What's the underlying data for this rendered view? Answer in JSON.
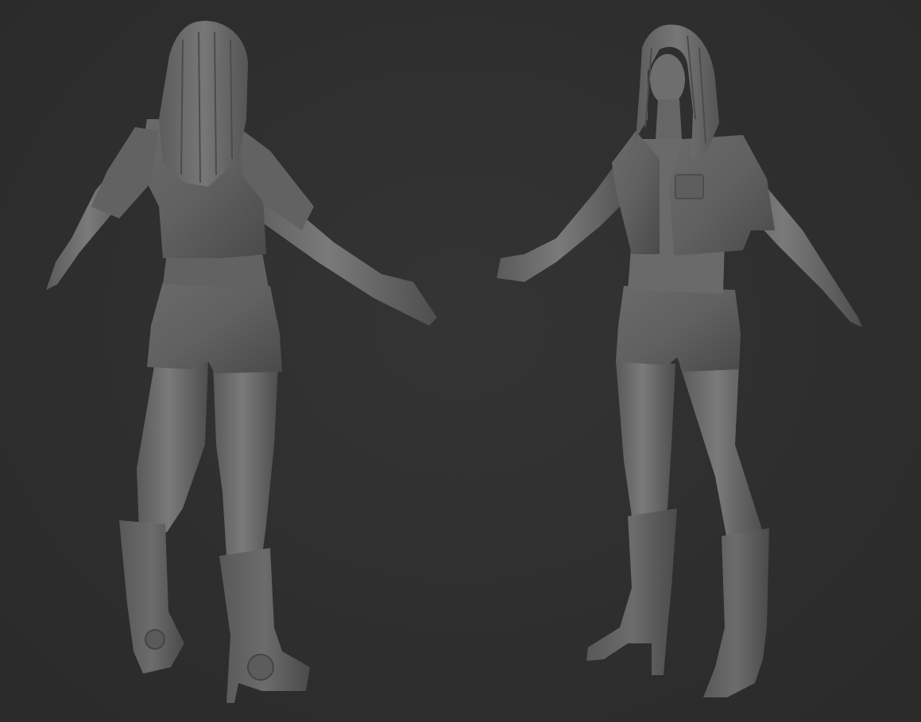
{
  "scene": {
    "background_color": "#2f2f2f",
    "material_color": "#6e6e6e",
    "views": [
      {
        "id": "back",
        "label": ""
      },
      {
        "id": "front",
        "label": ""
      }
    ]
  }
}
